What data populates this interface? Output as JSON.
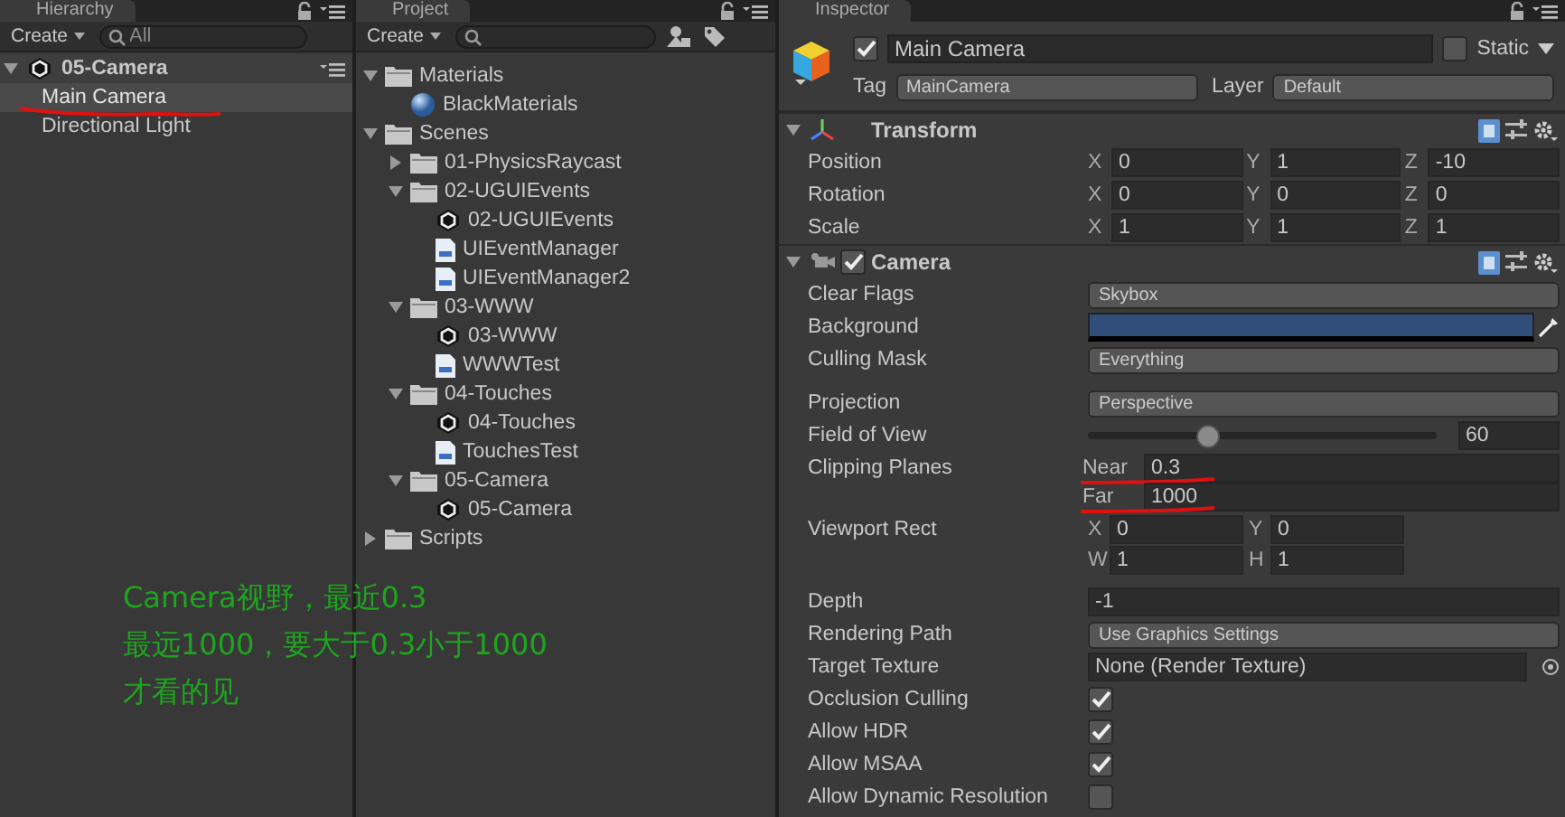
{
  "hierarchy": {
    "title": "Hierarchy",
    "create_button": "Create",
    "search_placeholder": "All",
    "scene": {
      "name": "05-Camera",
      "expanded": true,
      "children": [
        {
          "name": "Main Camera",
          "selected": true
        },
        {
          "name": "Directional Light",
          "selected": false
        }
      ]
    }
  },
  "project": {
    "title": "Project",
    "create_button": "Create",
    "tree": [
      {
        "name": "Materials",
        "kind": "folder",
        "expanded": true,
        "children": [
          {
            "name": "BlackMaterials",
            "kind": "material"
          }
        ]
      },
      {
        "name": "Scenes",
        "kind": "folder",
        "expanded": true,
        "children": [
          {
            "name": "01-PhysicsRaycast",
            "kind": "folder",
            "expanded": false
          },
          {
            "name": "02-UGUIEvents",
            "kind": "folder",
            "expanded": true,
            "children": [
              {
                "name": "02-UGUIEvents",
                "kind": "scene"
              },
              {
                "name": "UIEventManager",
                "kind": "script"
              },
              {
                "name": "UIEventManager2",
                "kind": "script"
              }
            ]
          },
          {
            "name": "03-WWW",
            "kind": "folder",
            "expanded": true,
            "children": [
              {
                "name": "03-WWW",
                "kind": "scene"
              },
              {
                "name": "WWWTest",
                "kind": "script"
              }
            ]
          },
          {
            "name": "04-Touches",
            "kind": "folder",
            "expanded": true,
            "children": [
              {
                "name": "04-Touches",
                "kind": "scene"
              },
              {
                "name": "TouchesTest",
                "kind": "script"
              }
            ]
          },
          {
            "name": "05-Camera",
            "kind": "folder",
            "expanded": true,
            "children": [
              {
                "name": "05-Camera",
                "kind": "scene"
              }
            ]
          }
        ]
      },
      {
        "name": "Scripts",
        "kind": "folder",
        "expanded": false
      }
    ]
  },
  "inspector": {
    "title": "Inspector",
    "object": {
      "active": true,
      "name": "Main Camera",
      "static": false,
      "static_label": "Static",
      "tag_label": "Tag",
      "tag": "MainCamera",
      "layer_label": "Layer",
      "layer": "Default"
    },
    "components": [
      {
        "name": "Transform",
        "kind": "transform",
        "expanded": true,
        "fields": [
          {
            "kind": "vector",
            "label": "Position",
            "axes": [
              {
                "axis": "X",
                "value": "0"
              },
              {
                "axis": "Y",
                "value": "1"
              },
              {
                "axis": "Z",
                "value": "-10"
              }
            ]
          },
          {
            "kind": "vector",
            "label": "Rotation",
            "axes": [
              {
                "axis": "X",
                "value": "0"
              },
              {
                "axis": "Y",
                "value": "0"
              },
              {
                "axis": "Z",
                "value": "0"
              }
            ]
          },
          {
            "kind": "vector",
            "label": "Scale",
            "axes": [
              {
                "axis": "X",
                "value": "1"
              },
              {
                "axis": "Y",
                "value": "1"
              },
              {
                "axis": "Z",
                "value": "1"
              }
            ]
          }
        ]
      },
      {
        "name": "Camera",
        "kind": "camera",
        "expanded": true,
        "enabled": true,
        "fields": [
          {
            "kind": "dropdown",
            "label": "Clear Flags",
            "value": "Skybox"
          },
          {
            "kind": "color",
            "label": "Background",
            "color": "#314d79"
          },
          {
            "kind": "dropdown",
            "label": "Culling Mask",
            "value": "Everything"
          },
          {
            "kind": "dropdown",
            "label": "Projection",
            "value": "Perspective",
            "gap": true
          },
          {
            "kind": "slider",
            "label": "Field of View",
            "level": 0.34,
            "value": "60"
          },
          {
            "kind": "pair",
            "label": "Clipping Planes",
            "items": [
              {
                "label": "Near",
                "value": "0.3"
              },
              {
                "label": "Far",
                "value": "1000"
              }
            ]
          },
          {
            "kind": "rect",
            "label": "Viewport Rect",
            "axes": [
              {
                "axis": "X",
                "value": "0"
              },
              {
                "axis": "Y",
                "value": "0"
              },
              {
                "axis": "W",
                "value": "1"
              },
              {
                "axis": "H",
                "value": "1"
              }
            ]
          },
          {
            "kind": "number",
            "label": "Depth",
            "value": "-1",
            "gap": true
          },
          {
            "kind": "dropdown",
            "label": "Rendering Path",
            "value": "Use Graphics Settings"
          },
          {
            "kind": "object",
            "label": "Target Texture",
            "value": "None (Render Texture)"
          },
          {
            "kind": "checkbox",
            "label": "Occlusion Culling",
            "checked": true
          },
          {
            "kind": "checkbox",
            "label": "Allow HDR",
            "checked": true
          },
          {
            "kind": "checkbox",
            "label": "Allow MSAA",
            "checked": true
          },
          {
            "kind": "checkbox",
            "label": "Allow Dynamic Resolution",
            "checked": false
          }
        ]
      }
    ]
  },
  "annotation": {
    "lines": [
      "Camera视野，最近0.3",
      "最远1000，要大于0.3小于1000",
      "才看的见"
    ]
  }
}
